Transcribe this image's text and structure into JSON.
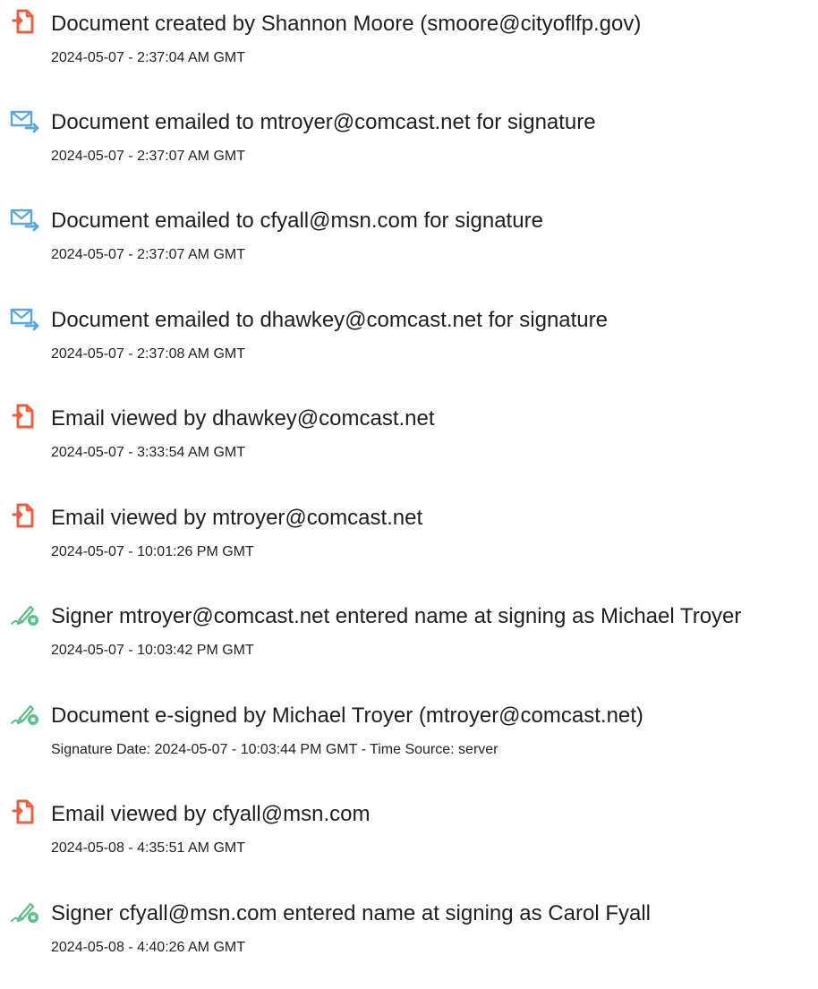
{
  "colors": {
    "doc_icon": "#e8613c",
    "mail_icon": "#5aa8e0",
    "sign_icon": "#5cbf88",
    "text": "#1f1f1f"
  },
  "events": [
    {
      "icon": "document-icon",
      "title": "Document created by Shannon Moore (smoore@cityoflfp.gov)",
      "time": "2024-05-07 - 2:37:04 AM GMT"
    },
    {
      "icon": "email-icon",
      "title": "Document emailed to mtroyer@comcast.net for signature",
      "time": "2024-05-07 - 2:37:07 AM GMT"
    },
    {
      "icon": "email-icon",
      "title": "Document emailed to cfyall@msn.com for signature",
      "time": "2024-05-07 - 2:37:07 AM GMT"
    },
    {
      "icon": "email-icon",
      "title": "Document emailed to dhawkey@comcast.net for signature",
      "time": "2024-05-07 - 2:37:08 AM GMT"
    },
    {
      "icon": "document-icon",
      "title": "Email viewed by dhawkey@comcast.net",
      "time": "2024-05-07 - 3:33:54 AM GMT"
    },
    {
      "icon": "document-icon",
      "title": "Email viewed by mtroyer@comcast.net",
      "time": "2024-05-07 - 10:01:26 PM GMT"
    },
    {
      "icon": "esign-icon",
      "title": "Signer mtroyer@comcast.net entered name at signing as Michael Troyer",
      "time": "2024-05-07 - 10:03:42 PM GMT"
    },
    {
      "icon": "esign-icon",
      "title": "Document e-signed by Michael Troyer (mtroyer@comcast.net)",
      "time": "Signature Date: 2024-05-07 - 10:03:44 PM GMT - Time Source: server"
    },
    {
      "icon": "document-icon",
      "title": "Email viewed by cfyall@msn.com",
      "time": "2024-05-08 - 4:35:51 AM GMT"
    },
    {
      "icon": "esign-icon",
      "title": "Signer cfyall@msn.com entered name at signing as Carol Fyall",
      "time": "2024-05-08 - 4:40:26 AM GMT"
    }
  ]
}
